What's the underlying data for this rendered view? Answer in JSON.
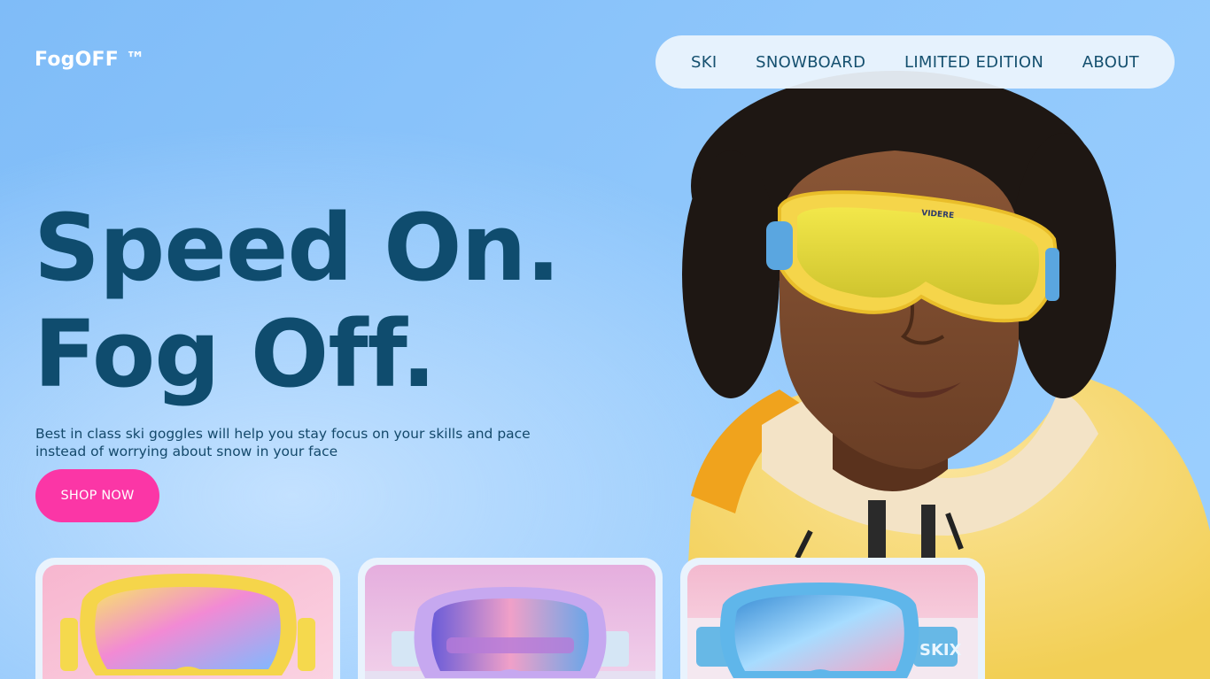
{
  "brand": {
    "logo": "FogOFF ™"
  },
  "nav": {
    "items": [
      {
        "label": "SKI"
      },
      {
        "label": "SNOWBOARD"
      },
      {
        "label": "LIMITED EDITION"
      },
      {
        "label": "ABOUT"
      }
    ]
  },
  "hero": {
    "headline_line1": "Speed On.",
    "headline_line2": "Fog Off.",
    "subtitle": "Best in class ski goggles will help you stay focus on your skills and pace instead of worrying about snow in your face",
    "cta": "SHOP NOW",
    "goggle_brand_mark": "VIDERE"
  },
  "products": [
    {
      "name": "yellow-goggles",
      "frame_color": "#f6d64a",
      "lens_color": "#f08ad0"
    },
    {
      "name": "purple-goggles",
      "frame_color": "#c8a7f2",
      "lens_color": "#b46ee8"
    },
    {
      "name": "blue-goggles",
      "frame_color": "#5fb6ea",
      "lens_color": "#9fd4ff",
      "strap_text": "SKIX"
    }
  ],
  "colors": {
    "accent": "#fb36a6",
    "headline": "#0f4c6e",
    "nav_bg": "#edf5fd",
    "background": "#8ec6fb"
  }
}
